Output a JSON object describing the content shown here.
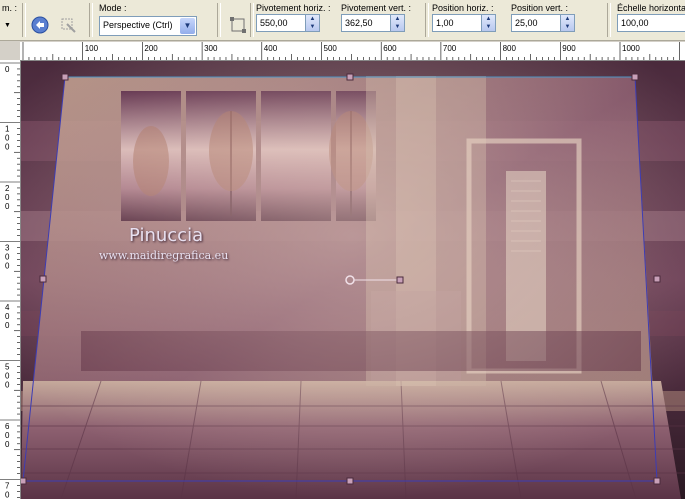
{
  "toolbar": {
    "left_label": "m. :",
    "mode_label": "Mode :",
    "mode_value": "Perspective (Ctrl)",
    "pivot_h_label": "Pivotement horiz. :",
    "pivot_h_value": "550,00",
    "pivot_v_label": "Pivotement vert. :",
    "pivot_v_value": "362,50",
    "pos_h_label": "Position horiz. :",
    "pos_h_value": "1,00",
    "pos_v_label": "Position vert. :",
    "pos_v_value": "25,00",
    "scale_h_label": "Échelle horizontale",
    "scale_h_value": "100,00"
  },
  "ruler": {
    "top_labels": [
      "100",
      "200",
      "300",
      "400",
      "500",
      "600",
      "700",
      "800",
      "900",
      "1000"
    ],
    "left_labels": [
      "0",
      "100",
      "200",
      "300",
      "400",
      "500",
      "600",
      "700"
    ]
  },
  "canvas": {
    "watermark_name": "Pinuccia",
    "watermark_url": "www.maidiregrafica.eu"
  },
  "colors": {
    "toolbar_bg": "#ece9d8",
    "selection_line": "#3c3cb4",
    "handle": "#c8a0b8"
  }
}
